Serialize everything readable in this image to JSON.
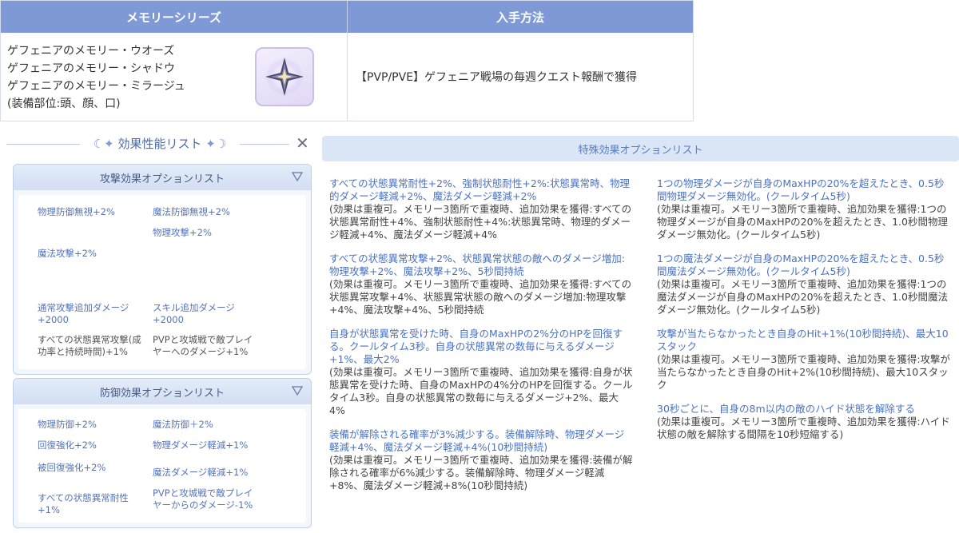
{
  "top": {
    "header_left": "メモリーシリーズ",
    "header_right": "入手方法",
    "memories": [
      "ゲフェニアのメモリー・ウオーズ",
      "ゲフェニアのメモリー・シャドウ",
      "ゲフェニアのメモリー・ミラージュ",
      "(装備部位:頭、顔、口)"
    ],
    "obtain": "【PVP/PVE】ゲフェニア戦場の毎週クエスト報酬で獲得",
    "icon": "crystal-star-icon"
  },
  "left": {
    "title": "効果性能リスト",
    "attack": {
      "title": "攻撃効果オプションリスト",
      "options": [
        "物理防御無視+2%",
        "魔法防御無視+2%",
        "物理攻撃+2%",
        "魔法攻撃+2%",
        "通常攻撃追加ダメージ+2000",
        "スキル追加ダメージ+2000",
        "すべての状態異常攻撃(成功率と持続時間)+1%",
        "PVPと攻城戦で敵プレイヤーへのダメージ+1%"
      ]
    },
    "defense": {
      "title": "防御効果オプションリスト",
      "options": [
        "物理防御+2%",
        "魔法防御＋2%",
        "回復強化+2%",
        "物理ダメージ軽減+1%",
        "被回復強化+2%",
        "魔法ダメージ軽減+1%",
        "すべての状態異常耐性+1%",
        "PVPと攻城戦で敵プレイヤーからのダメージ-1%"
      ]
    }
  },
  "right": {
    "title": "特殊効果オプションリスト",
    "col1": [
      {
        "t": "すべての状態異常耐性+2%、強制状態耐性+2%:状態異常時、物理的ダメージ軽減+2%、魔法ダメージ軽減+2%",
        "d": "(効果は重複可。メモリー3箇所で重複時、追加効果を獲得:すべての状態異常耐性+4%、強制状態耐性+4%:状態異常時、物理的ダメージ軽減+4%、魔法ダメージ軽減+4%"
      },
      {
        "t": "すべての状態異常攻撃+2%、状態異常状態の敵へのダメージ増加:物理攻撃+2%、魔法攻撃+2%、5秒間持続",
        "d": "(効果は重複可。メモリー3箇所で重複時、追加効果を獲得:すべての状態異常攻撃+4%、状態異常状態の敵へのダメージ増加:物理攻撃+4%、魔法攻撃+4%、5秒間持続"
      },
      {
        "t": "自身が状態異常を受けた時、自身のMaxHPの2%分のHPを回復する。クールタイム3秒。自身の状態異常の数毎に与えるダメージ+1%、最大2%",
        "d": "(効果は重複可。メモリー3箇所で重複時、追加効果を獲得:自身が状態異常を受けた時、自身のMaxHPの4%分のHPを回復する。クールタイム3秒。自身の状態異常の数毎に与えるダメージ+2%、最大4%"
      },
      {
        "t": "装備が解除される確率が3%減少する。装備解除時、物理ダメージ軽減+4%、魔法ダメージ軽減+4%(10秒間持続)",
        "d": "(効果は重複可。メモリー3箇所で重複時、追加効果を獲得:装備が解除される確率が6%減少する。装備解除時、物理ダメージ軽減+8%、魔法ダメージ軽減+8%(10秒間持続)"
      }
    ],
    "col2": [
      {
        "t": "1つの物理ダメージが自身のMaxHPの20%を超えたとき、0.5秒間物理ダメージ無効化。(クールタイム5秒)",
        "d": "(効果は重複可。メモリー3箇所で重複時、追加効果を獲得:1つの物理ダメージが自身のMaxHPの20%を超えたとき、1.0秒間物理ダメージ無効化。(クールタイム5秒)"
      },
      {
        "t": "1つの魔法ダメージが自身のMaxHPの20%を超えたとき、0.5秒間魔法ダメージ無効化。(クールタイム5秒)",
        "d": "(効果は重複可。メモリー3箇所で重複時、追加効果を獲得:1つの魔法ダメージが自身のMaxHPの20%を超えたとき、1.0秒間魔法ダメージ無効化。(クールタイム5秒)"
      },
      {
        "t": "攻撃が当たらなかったとき自身のHit+1%(10秒間持続)、最大10スタック",
        "d": "(効果は重複可。メモリー3箇所で重複時、追加効果を獲得:攻撃が当たらなかったとき自身のHit+2%(10秒間持続)、最大10スタック"
      },
      {
        "t": "30秒ごとに、自身の8m以内の敵のハイド状態を解除する",
        "d": "(効果は重複可。メモリー3箇所で重複時、追加効果を獲得:ハイド状態の敵を解除する間隔を10秒短縮する)"
      }
    ]
  },
  "colors": {
    "header_blue": "#7f98d6",
    "link_blue": "#4a72c4",
    "panel_bg": "#dae6f6"
  }
}
